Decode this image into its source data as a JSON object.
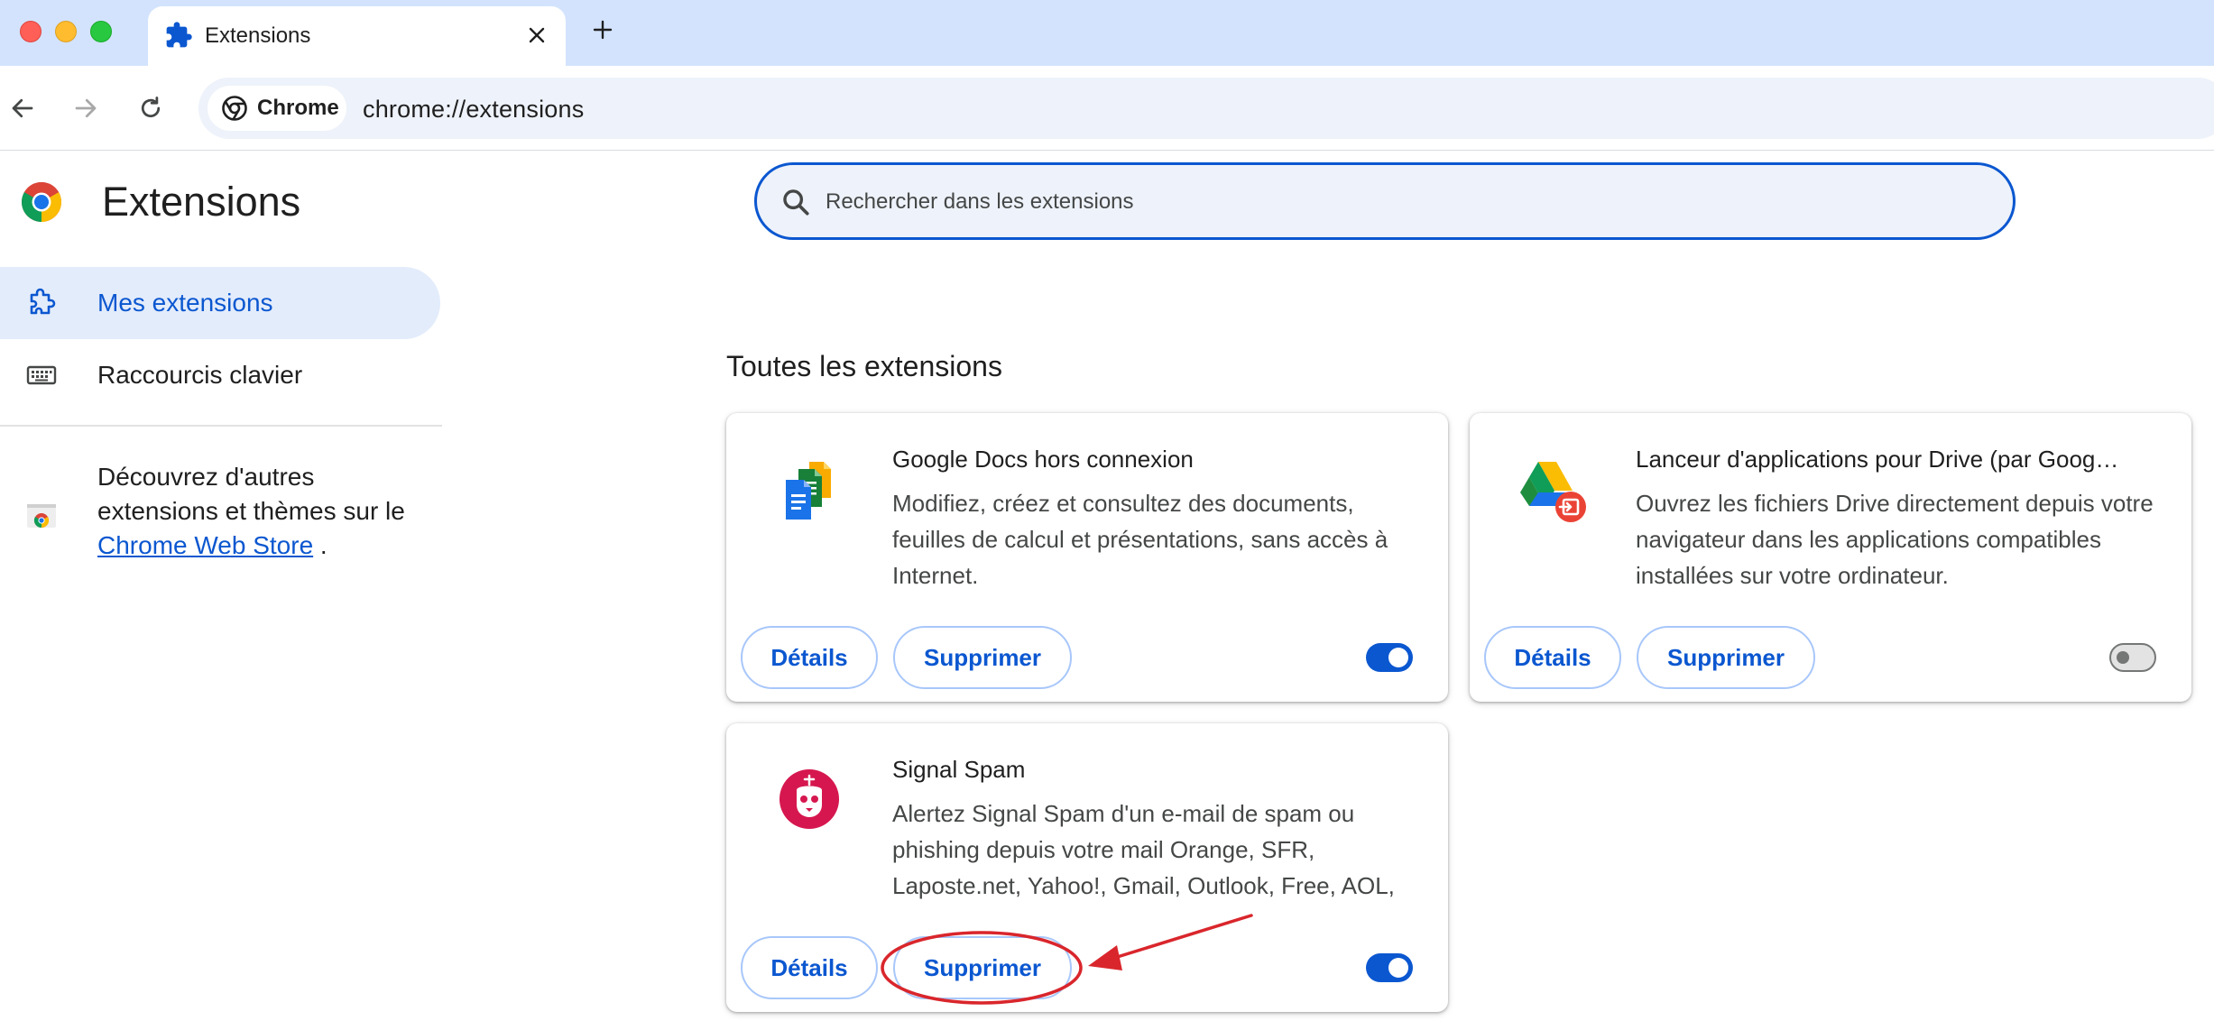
{
  "window": {
    "tab_title": "Extensions",
    "tab_icon": "puzzle-icon",
    "close_tab_icon": "close-icon",
    "new_tab_icon": "plus-icon"
  },
  "toolbar": {
    "chip_label": "Chrome",
    "url": "chrome://extensions"
  },
  "page": {
    "title": "Extensions"
  },
  "sidebar": {
    "items": [
      {
        "label": "Mes extensions",
        "icon": "extension-icon",
        "active": true
      },
      {
        "label": "Raccourcis clavier",
        "icon": "keyboard-icon",
        "active": false
      }
    ],
    "store_text_before": "Découvrez d'autres extensions et thèmes sur le ",
    "store_link": "Chrome Web Store",
    "store_text_after": " ."
  },
  "search": {
    "placeholder": "Rechercher dans les extensions"
  },
  "section_title": "Toutes les extensions",
  "extensions": [
    {
      "name": "Google Docs hors connexion",
      "description": "Modifiez, créez et consultez des documents, feuilles de calcul et présentations, sans accès à Internet.",
      "details_label": "Détails",
      "remove_label": "Supprimer",
      "enabled": true,
      "icon": "google-docs-icon"
    },
    {
      "name": "Lanceur d'applications pour Drive (par Goog…",
      "description": "Ouvrez les fichiers Drive directement depuis votre navigateur dans les applications compatibles installées sur votre ordinateur.",
      "details_label": "Détails",
      "remove_label": "Supprimer",
      "enabled": false,
      "icon": "google-drive-icon"
    },
    {
      "name": "Signal Spam",
      "description": "Alertez Signal Spam d'un e-mail de spam ou phishing depuis votre mail Orange, SFR, Laposte.net, Yahoo!, Gmail, Outlook, Free, AOL,",
      "details_label": "Détails",
      "remove_label": "Supprimer",
      "enabled": true,
      "icon": "signal-spam-icon"
    }
  ],
  "colors": {
    "accent": "#0b57d0",
    "tabstrip": "#d3e3fd",
    "annotation": "#d9262c"
  }
}
